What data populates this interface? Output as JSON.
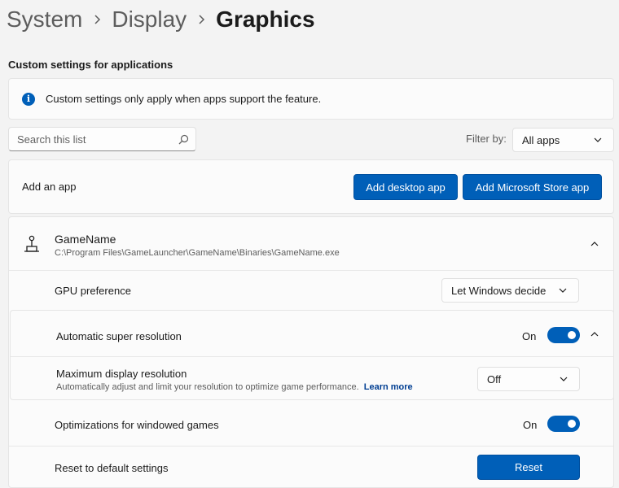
{
  "breadcrumb": [
    "System",
    "Display",
    "Graphics"
  ],
  "section_title": "Custom settings for applications",
  "info": {
    "text": "Custom settings only apply when apps support the feature."
  },
  "search": {
    "placeholder": "Search this list"
  },
  "filter": {
    "label": "Filter by:",
    "value": "All apps"
  },
  "add_app": {
    "label": "Add an app",
    "desktop_button": "Add desktop app",
    "store_button": "Add Microsoft Store app"
  },
  "app": {
    "name": "GameName",
    "path": "C:\\Program Files\\GameLauncher\\GameName\\Binaries\\GameName.exe",
    "gpu_preference": {
      "label": "GPU preference",
      "value": "Let Windows decide"
    },
    "auto_super_resolution": {
      "label": "Automatic super resolution",
      "state": "On"
    },
    "max_display_resolution": {
      "label": "Maximum display resolution",
      "description": "Automatically adjust and limit your resolution to optimize game performance.",
      "link": "Learn more",
      "value": "Off"
    },
    "windowed_optimizations": {
      "label": "Optimizations for windowed games",
      "state": "On"
    },
    "reset": {
      "label": "Reset to default settings",
      "button": "Reset"
    }
  },
  "colors": {
    "accent": "#005fb8",
    "background": "#f3f3f3",
    "card": "#fbfbfb"
  }
}
